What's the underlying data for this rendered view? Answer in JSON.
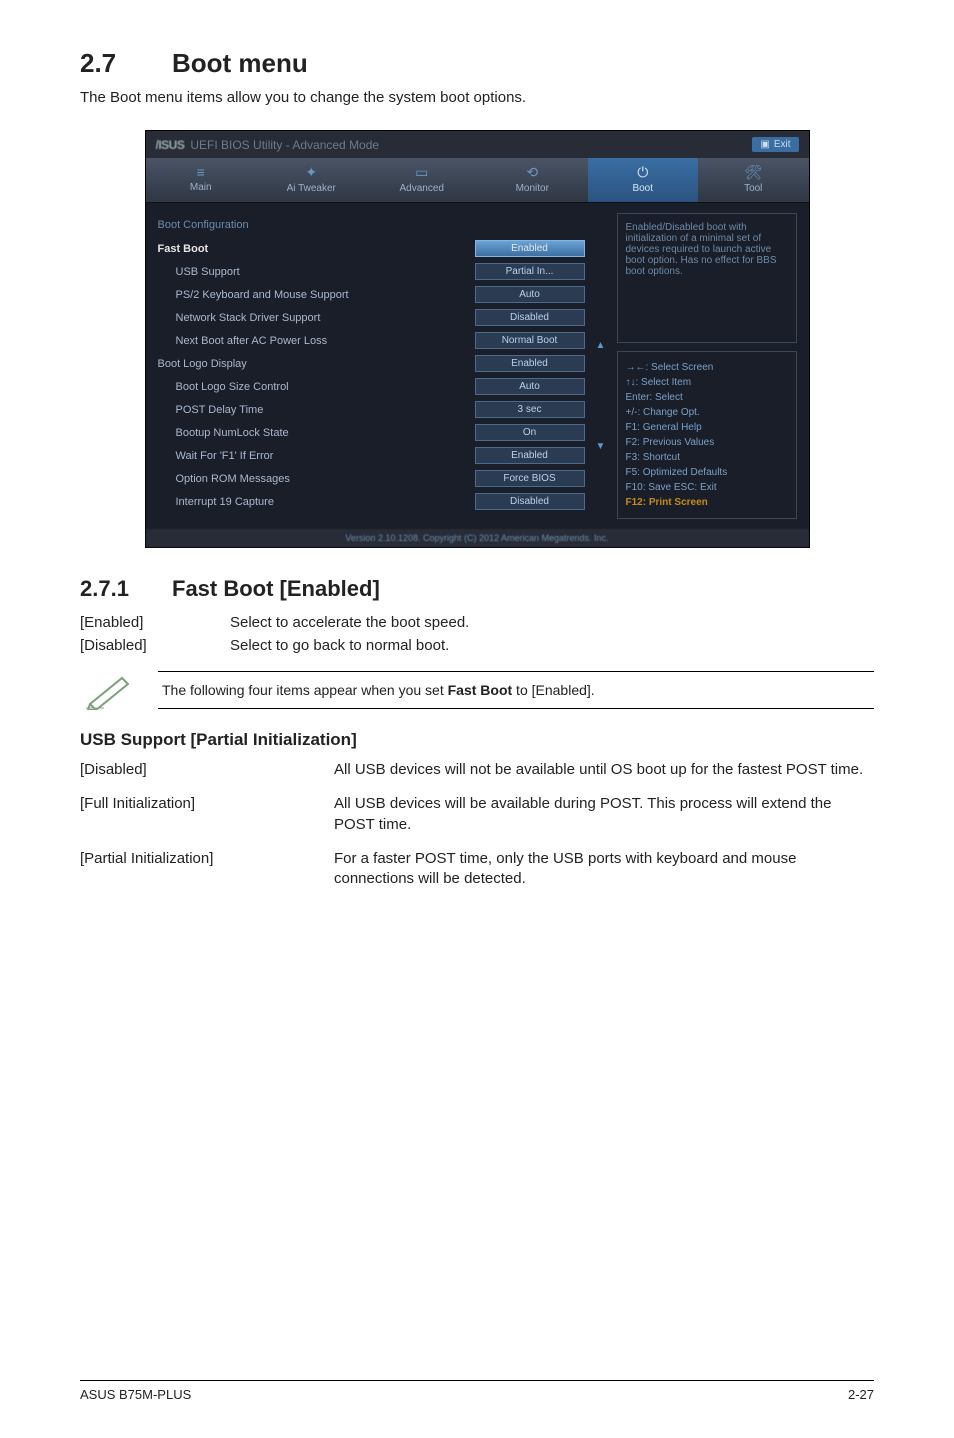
{
  "section": {
    "number": "2.7",
    "title": "Boot menu"
  },
  "intro": "The Boot menu items allow you to change the system boot options.",
  "bios": {
    "header": {
      "logo": "/ISUS",
      "title": "UEFI BIOS Utility - Advanced Mode",
      "exit": "Exit"
    },
    "tabs": [
      {
        "icon": "≡",
        "label": "Main"
      },
      {
        "icon": "✦",
        "label": "Ai Tweaker"
      },
      {
        "icon": "▭",
        "label": "Advanced"
      },
      {
        "icon": "⟲",
        "label": "Monitor"
      },
      {
        "icon": "⏻",
        "label": "Boot",
        "active": true
      },
      {
        "icon": "🛠",
        "label": "Tool"
      }
    ],
    "group1_title": "Boot Configuration",
    "rows1": [
      {
        "label": "Fast Boot",
        "value": "Enabled",
        "selected": true,
        "indent": false
      },
      {
        "label": "USB Support",
        "value": "Partial In...",
        "indent": true
      },
      {
        "label": "PS/2 Keyboard and Mouse Support",
        "value": "Auto",
        "indent": true
      },
      {
        "label": "Network Stack Driver Support",
        "value": "Disabled",
        "indent": true
      },
      {
        "label": "Next Boot after AC Power Loss",
        "value": "Normal Boot",
        "indent": true
      }
    ],
    "group2_title": "Boot Logo Display",
    "rows2": [
      {
        "label": "Boot Logo Size Control",
        "value": "Auto",
        "indent": true
      },
      {
        "label": "POST Delay Time",
        "value": "3 sec",
        "indent": true
      },
      {
        "label": "Bootup NumLock State",
        "value": "On",
        "indent": true
      },
      {
        "label": "Wait For 'F1' If Error",
        "value": "Enabled",
        "indent": true
      },
      {
        "label": "Option ROM Messages",
        "value": "Force BIOS",
        "indent": true
      },
      {
        "label": "Interrupt 19 Capture",
        "value": "Disabled",
        "indent": true
      }
    ],
    "group2_value": "Enabled",
    "help_text": "Enabled/Disabled boot with initialization of a minimal set of devices required to launch active boot option. Has no effect for BBS boot options.",
    "keys": [
      "→←: Select Screen",
      "↑↓: Select Item",
      "Enter: Select",
      "+/-: Change Opt.",
      "F1: General Help",
      "F2: Previous Values",
      "F3: Shortcut",
      "F5: Optimized Defaults",
      "F10: Save  ESC: Exit"
    ],
    "keys_last": "F12: Print Screen",
    "copyright": "Version 2.10.1208. Copyright (C) 2012 American Megatrends. Inc."
  },
  "subsection": {
    "number": "2.7.1",
    "title": "Fast Boot [Enabled]"
  },
  "fastboot_opts": [
    {
      "key": "[Enabled]",
      "desc": "Select to accelerate the boot speed."
    },
    {
      "key": "[Disabled]",
      "desc": "Select to go back to normal boot."
    }
  ],
  "note": {
    "prefix": "The following four items appear when you set ",
    "bold": "Fast Boot",
    "suffix": " to [Enabled]."
  },
  "usb": {
    "title": "USB Support [Partial Initialization]",
    "rows": [
      {
        "key": "[Disabled]",
        "desc": "All USB devices will not be available until OS boot up for the fastest POST time."
      },
      {
        "key": "[Full Initialization]",
        "desc": "All USB devices will be available during POST. This process will extend the POST time."
      },
      {
        "key": "[Partial Initialization]",
        "desc": "For a faster POST time, only the USB ports with keyboard and mouse connections will be detected."
      }
    ]
  },
  "footer": {
    "left": "ASUS B75M-PLUS",
    "right": "2-27"
  }
}
